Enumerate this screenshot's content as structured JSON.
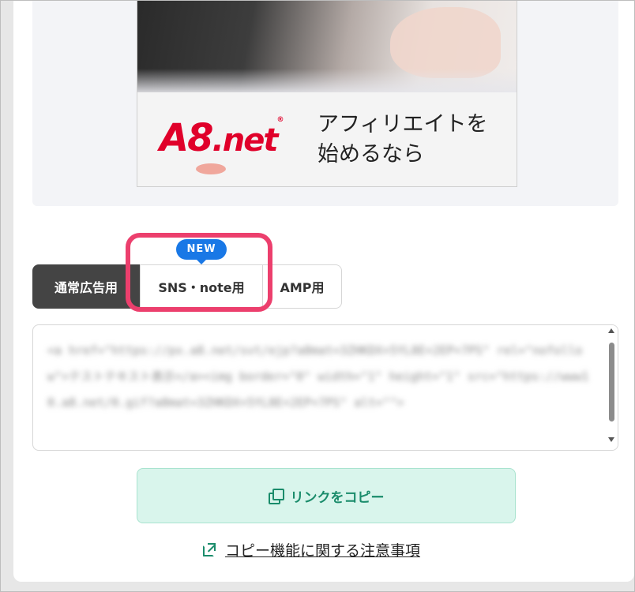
{
  "banner": {
    "logo_main": "A8",
    "logo_suffix": ".net",
    "logo_reg": "®",
    "tagline_line1": "アフィリエイトを",
    "tagline_line2": "始めるなら"
  },
  "tabs": {
    "normal": "通常広告用",
    "sns": "SNS・note用",
    "amp": "AMP用",
    "new_badge": "NEW"
  },
  "code": {
    "text": "<a href=\"https://px.a8.net/svt/ejp?a8mat=3ZHKDX+5YL8E+2EP+7PS\" rel=\"nofollow\">テストテキスト表示</a><img border=\"0\" width=\"1\" height=\"1\" src=\"https://www10.a8.net/0.gif?a8mat=3ZHKDX+5YL8E+2EP+7PS\" alt=\"\">"
  },
  "copy_button": {
    "label": "リンクをコピー"
  },
  "notice_link": {
    "label": "コピー機能に関する注意事項"
  },
  "colors": {
    "accent_green": "#1a8c6b",
    "badge_blue": "#1978e6",
    "highlight_pink": "#ec3f6d",
    "logo_red": "#e0002a"
  }
}
